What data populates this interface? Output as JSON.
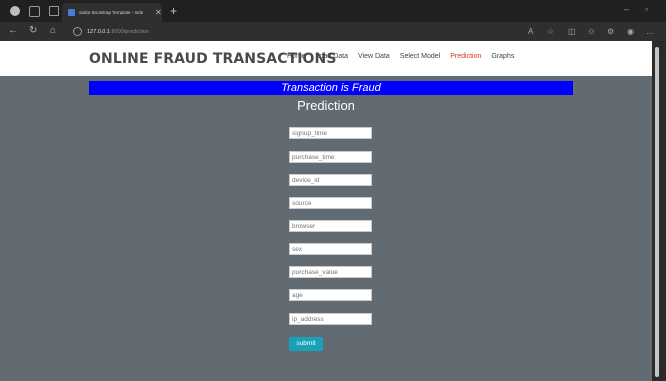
{
  "browser": {
    "tab_title": "Sailor Bootstrap Template - Inde",
    "url_host": "127.0.0.1",
    "url_path": ":8000/prediction"
  },
  "navbar": {
    "brand": "ONLINE FRAUD TRANSACTIONS",
    "links": [
      "Home",
      "Load Data",
      "View Data",
      "Select Model",
      "Prediction",
      "Graphs"
    ],
    "active": "Prediction"
  },
  "result": {
    "banner": "Transaction is Fraud",
    "banner_color": "#0000ff"
  },
  "form": {
    "heading": "Prediction",
    "fields": [
      {
        "placeholder": "signup_time"
      },
      {
        "placeholder": "purchase_time"
      },
      {
        "placeholder": "device_id"
      },
      {
        "placeholder": "source"
      },
      {
        "placeholder": "browser"
      },
      {
        "placeholder": "sex"
      },
      {
        "placeholder": "purchase_value"
      },
      {
        "placeholder": "age"
      },
      {
        "placeholder": "ip_address"
      }
    ],
    "submit_label": "submit"
  },
  "colors": {
    "page_bg": "#636b72",
    "active_link": "#d9321c",
    "submit_bg": "#17a2b8"
  }
}
